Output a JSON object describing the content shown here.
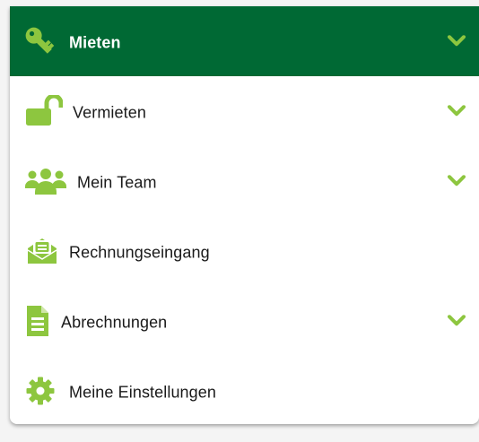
{
  "colors": {
    "brand_green": "#006934",
    "icon_green": "#8dc63f",
    "text": "#1a1a1a",
    "active_text": "#ffffff"
  },
  "menu": {
    "items": [
      {
        "label": "Mieten",
        "icon": "key-icon",
        "active": true,
        "has_chevron": true
      },
      {
        "label": "Vermieten",
        "icon": "unlock-icon",
        "active": false,
        "has_chevron": true
      },
      {
        "label": "Mein Team",
        "icon": "users-icon",
        "active": false,
        "has_chevron": true
      },
      {
        "label": "Rechnungseingang",
        "icon": "envelope-open-icon",
        "active": false,
        "has_chevron": false
      },
      {
        "label": "Abrechnungen",
        "icon": "document-icon",
        "active": false,
        "has_chevron": true
      },
      {
        "label": "Meine Einstellungen",
        "icon": "gear-icon",
        "active": false,
        "has_chevron": false
      }
    ]
  }
}
